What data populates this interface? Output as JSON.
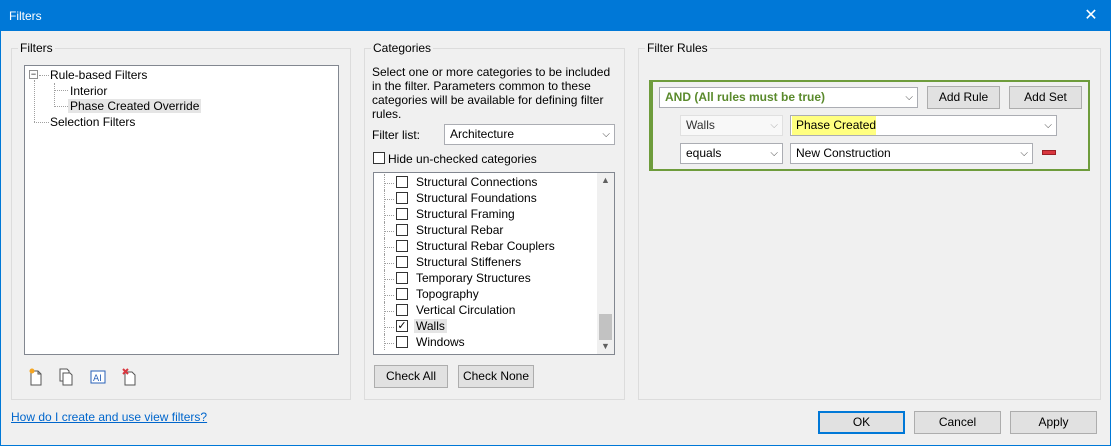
{
  "window": {
    "title": "Filters",
    "close_glyph": "✕"
  },
  "filters_panel": {
    "title": "Filters",
    "tree": {
      "rule_based": "Rule-based Filters",
      "interior": "Interior",
      "phase_override": "Phase Created Override",
      "selection": "Selection Filters"
    },
    "toolbar_icons": [
      "new-filter-icon",
      "duplicate-filter-icon",
      "rename-filter-icon",
      "delete-filter-icon"
    ]
  },
  "categories_panel": {
    "title": "Categories",
    "description": "Select one or more categories to be included in the filter.  Parameters common to these categories will be available for defining filter rules.",
    "filter_list_label": "Filter list:",
    "filter_list_value": "Architecture",
    "hide_unchecked_label": "Hide un-checked categories",
    "items": [
      {
        "label": "Structural Connections",
        "checked": false
      },
      {
        "label": "Structural Foundations",
        "checked": false
      },
      {
        "label": "Structural Framing",
        "checked": false
      },
      {
        "label": "Structural Rebar",
        "checked": false
      },
      {
        "label": "Structural Rebar Couplers",
        "checked": false
      },
      {
        "label": "Structural Stiffeners",
        "checked": false
      },
      {
        "label": "Temporary Structures",
        "checked": false
      },
      {
        "label": "Topography",
        "checked": false
      },
      {
        "label": "Vertical Circulation",
        "checked": false
      },
      {
        "label": "Walls",
        "checked": true
      },
      {
        "label": "Windows",
        "checked": false
      }
    ],
    "check_all": "Check All",
    "check_none": "Check None"
  },
  "rules_panel": {
    "title": "Filter Rules",
    "and_combo": "AND (All rules must be true)",
    "add_rule": "Add Rule",
    "add_set": "Add Set",
    "category_combo": "Walls",
    "parameter_combo": "Phase Created",
    "operator_combo": "equals",
    "value_combo": "New Construction",
    "accent_color": "#6e9c3c",
    "highlight_color": "#ffff80",
    "remove_color": "#d9363e"
  },
  "footer": {
    "help_link": "How do I create and use view filters?",
    "ok": "OK",
    "cancel": "Cancel",
    "apply": "Apply"
  }
}
